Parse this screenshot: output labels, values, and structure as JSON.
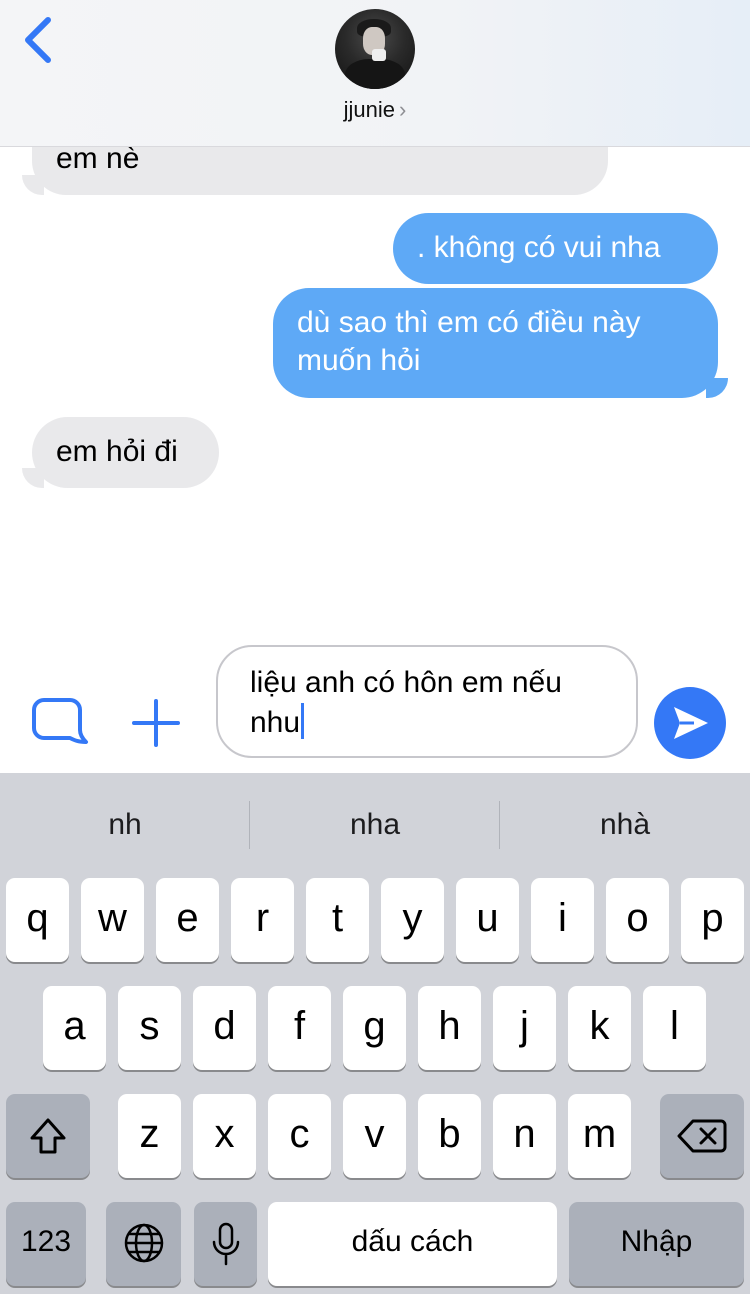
{
  "header": {
    "contact_name": "jjunie",
    "chevron": "›",
    "back_icon": "chevron-left-icon",
    "accent_color": "#3478f6"
  },
  "messages": [
    {
      "type": "incoming",
      "text": "em nè"
    },
    {
      "type": "outgoing",
      "text": ". không có vui nha"
    },
    {
      "type": "outgoing",
      "line1": "dù sao thì em có điều này",
      "line2": "muốn hỏi"
    },
    {
      "type": "incoming",
      "text": "em hỏi đi"
    }
  ],
  "composer": {
    "line1": "liệu anh có hôn em nếu",
    "line2": "nhu",
    "apps_icon": "app-store-icon",
    "plus_icon": "plus-icon",
    "send_icon": "send-arrow-icon"
  },
  "keyboard": {
    "suggestions": [
      "nh",
      "nha",
      "nhà"
    ],
    "row1": [
      "q",
      "w",
      "e",
      "r",
      "t",
      "y",
      "u",
      "i",
      "o",
      "p"
    ],
    "row2": [
      "a",
      "s",
      "d",
      "f",
      "g",
      "h",
      "j",
      "k",
      "l"
    ],
    "row3": [
      "z",
      "x",
      "c",
      "v",
      "b",
      "n",
      "m"
    ],
    "numbers_label": "123",
    "space_label": "dấu cách",
    "return_label": "Nhập",
    "shift_icon": "shift-arrow-icon",
    "delete_icon": "backspace-icon",
    "globe_icon": "globe-icon",
    "mic_icon": "microphone-icon"
  }
}
